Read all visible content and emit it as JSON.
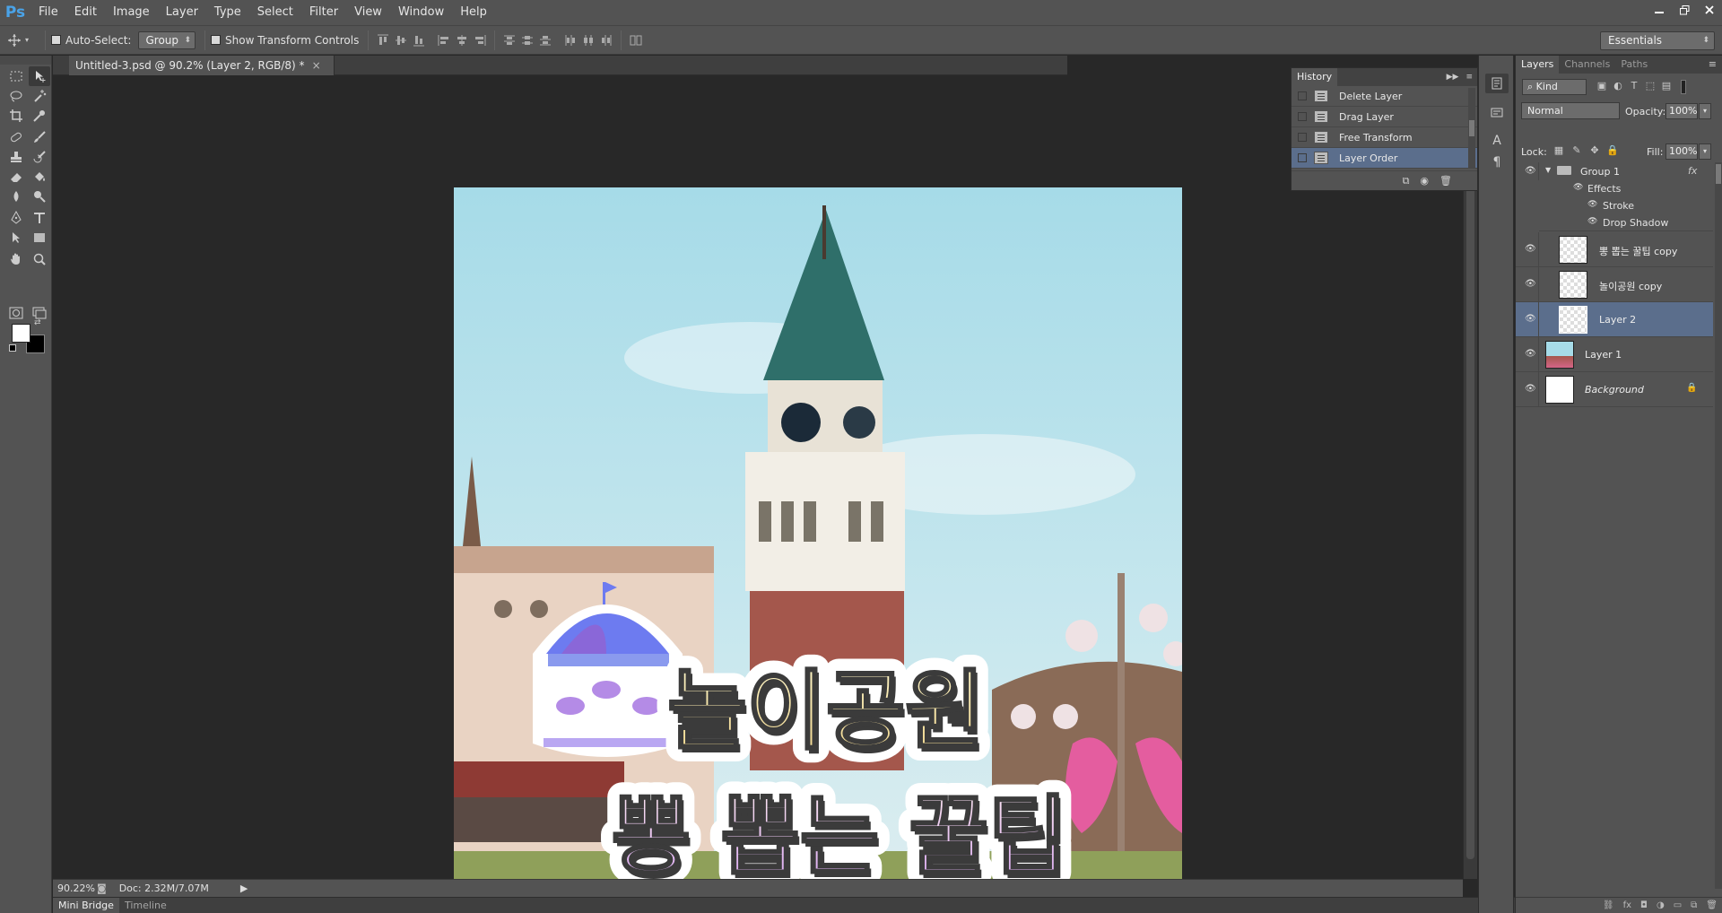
{
  "app": {
    "logo": "Ps",
    "menu": [
      "File",
      "Edit",
      "Image",
      "Layer",
      "Type",
      "Select",
      "Filter",
      "View",
      "Window",
      "Help"
    ],
    "window_controls": [
      "minimize-icon",
      "restore-icon",
      "close-icon"
    ]
  },
  "options_bar": {
    "auto_select_label": "Auto-Select:",
    "auto_select_checked": false,
    "auto_select_value": "Group",
    "show_transform_label": "Show Transform Controls",
    "show_transform_checked": false,
    "workspace": "Essentials"
  },
  "document": {
    "tab_title": "Untitled-3.psd @ 90.2% (Layer 2, RGB/8) *",
    "artwork": {
      "title_line1": "놀이공원",
      "title_line2": "뽕 뽑는 꿀팁"
    }
  },
  "status_bar": {
    "zoom": "90.22%",
    "doc_info": "Doc: 2.32M/7.07M"
  },
  "bottom_tabs": [
    "Mini Bridge",
    "Timeline"
  ],
  "history": {
    "tab_label": "History",
    "items": [
      {
        "label": "Delete Layer",
        "selected": false
      },
      {
        "label": "Drag Layer",
        "selected": false
      },
      {
        "label": "Free Transform",
        "selected": false
      },
      {
        "label": "Layer Order",
        "selected": true
      }
    ]
  },
  "layers_panel": {
    "tabs": [
      "Layers",
      "Channels",
      "Paths"
    ],
    "filter_label": "Kind",
    "blend_mode": "Normal",
    "opacity_label": "Opacity:",
    "opacity_value": "100%",
    "lock_label": "Lock:",
    "fill_label": "Fill:",
    "fill_value": "100%",
    "group": {
      "name": "Group 1",
      "fx_label": "fx",
      "effects_label": "Effects",
      "effects": [
        "Stroke",
        "Drop Shadow"
      ]
    },
    "layers": [
      {
        "name": "뽕 뽑는 꿀팁 copy",
        "selected": false
      },
      {
        "name": "놀이공원 copy",
        "selected": false
      },
      {
        "name": "Layer 2",
        "selected": true
      },
      {
        "name": "Layer 1",
        "selected": false
      },
      {
        "name": "Background",
        "selected": false,
        "locked": true
      }
    ]
  },
  "colors": {
    "panel_bg": "#535353",
    "canvas_bg": "#282828",
    "selection": "#5b6e8c",
    "accent_logo": "#4aa3e8"
  }
}
